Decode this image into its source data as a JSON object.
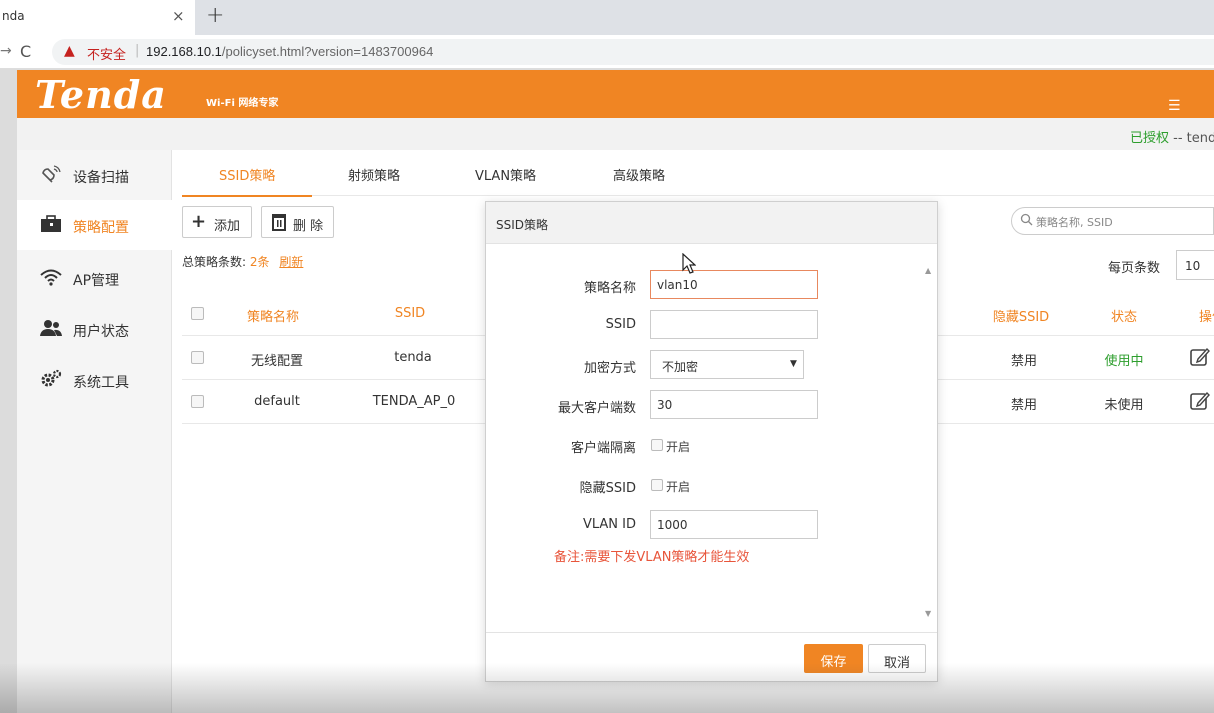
{
  "browser": {
    "tab_title": "nda",
    "tab_close": "×",
    "new_tab": "+",
    "security_warning": "不安全",
    "url_host": "192.168.10.1",
    "url_path": "/policyset.html?version=1483700964"
  },
  "header": {
    "logo": "Tenda",
    "logo_sub": "Wi-Fi 网络专家",
    "auth_status": "已授权",
    "auth_user": " -- tend"
  },
  "sidebar": {
    "items": [
      {
        "label": "设备扫描",
        "icon": "scan-device-icon"
      },
      {
        "label": "策略配置",
        "icon": "briefcase-icon"
      },
      {
        "label": "AP管理",
        "icon": "wifi-icon"
      },
      {
        "label": "用户状态",
        "icon": "users-icon"
      },
      {
        "label": "系统工具",
        "icon": "gears-icon"
      }
    ]
  },
  "tabs": [
    "SSID策略",
    "射频策略",
    "VLAN策略",
    "高级策略"
  ],
  "toolbar": {
    "add_label": "添加",
    "delete_label": "删 除",
    "total_prefix": "总策略条数:",
    "total_count": "2条",
    "refresh": "刷新",
    "search_placeholder": "策略名称, SSID",
    "per_page_label": "每页条数",
    "per_page_value": "10"
  },
  "table": {
    "headers": {
      "name": "策略名称",
      "ssid": "SSID",
      "hidden_ssid": "隐藏SSID",
      "status": "状态",
      "action": "操作"
    },
    "rows": [
      {
        "name": "无线配置",
        "ssid": "tenda",
        "hidden_ssid": "禁用",
        "status": "使用中"
      },
      {
        "name": "default",
        "ssid": "TENDA_AP_0",
        "hidden_ssid": "禁用",
        "status": "未使用"
      }
    ]
  },
  "modal": {
    "title": "SSID策略",
    "fields": {
      "name_label": "策略名称",
      "name_value": "vlan10",
      "ssid_label": "SSID",
      "ssid_value": "",
      "encryption_label": "加密方式",
      "encryption_value": "不加密",
      "max_clients_label": "最大客户端数",
      "max_clients_value": "30",
      "isolation_label": "客户端隔离",
      "isolation_option": "开启",
      "hide_ssid_label": "隐藏SSID",
      "hide_ssid_option": "开启",
      "vlan_label": "VLAN ID",
      "vlan_value": "1000"
    },
    "note": "备注:需要下发VLAN策略才能生效",
    "save_label": "保存",
    "cancel_label": "取消"
  },
  "colors": {
    "brand": "#f08523",
    "active_green": "#2d9e2d",
    "note_red": "#e8553b"
  }
}
